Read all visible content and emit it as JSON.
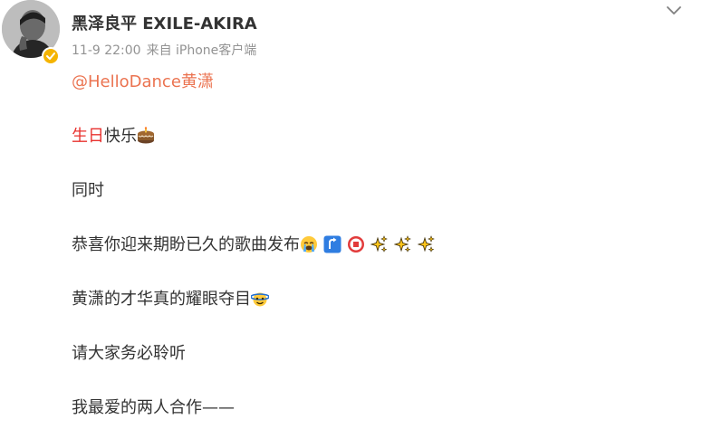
{
  "post": {
    "author": {
      "name": "黑泽良平 EXILE-AKIRA"
    },
    "meta": {
      "time": "11-9 22:00",
      "source_prefix": "来自",
      "source": "iPhone客户端"
    },
    "content": {
      "mention": "@HelloDance黄潇",
      "line1_highlight": "生日",
      "line1_rest": "快乐",
      "line2": "同时",
      "line3": "恭喜你迎来期盼已久的歌曲发布",
      "line4": "黄潇的才华真的耀眼夺目",
      "line5": "请大家务必聆听",
      "line6": "我最爱的两人合作——"
    },
    "icons": {
      "more": "chevron-down-icon",
      "verified": "verified-badge-icon",
      "cake": "cake-emoji",
      "crying": "crying-face-emoji",
      "arrow": "arrow-up-emoji",
      "celebrate": "blessing-emoji",
      "sparkles": "sparkles-emoji",
      "shine": "dazzled-face-emoji"
    },
    "colors": {
      "mention": "#eb7350",
      "highlight": "#e8312e",
      "text": "#333333",
      "meta": "#939393",
      "verified": "#f5b400"
    }
  }
}
